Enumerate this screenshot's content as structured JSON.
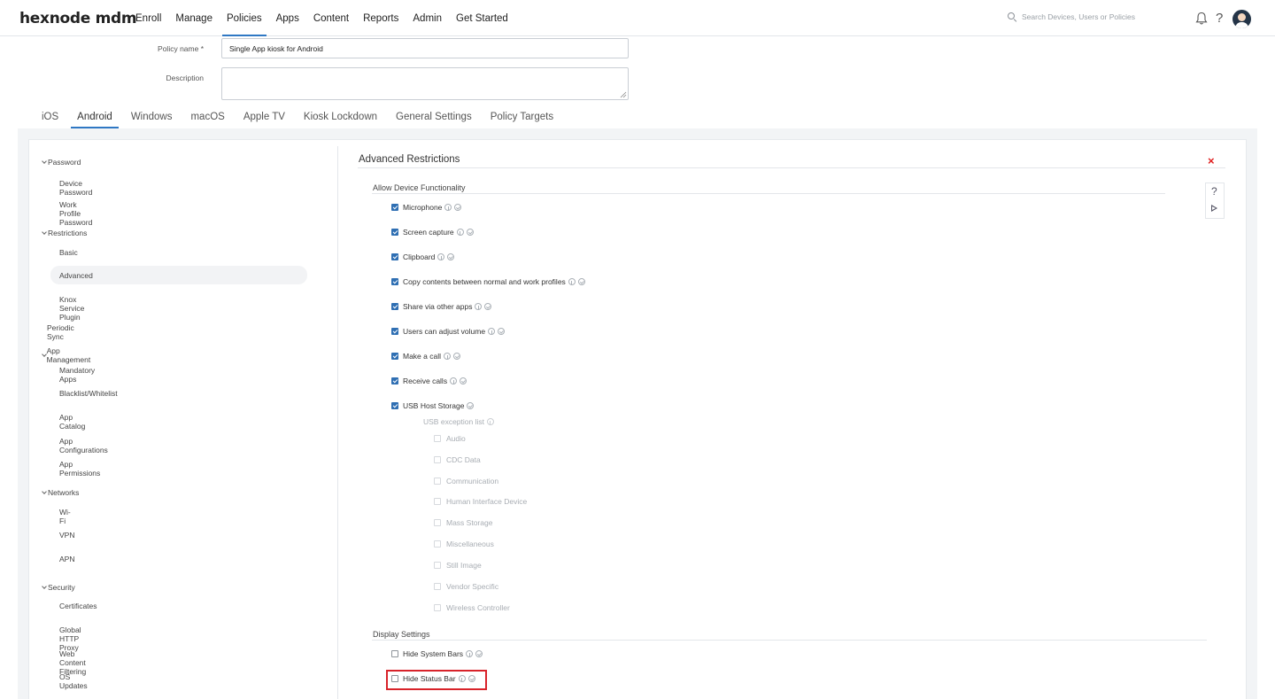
{
  "brand": {
    "logo": "hexnode mdm"
  },
  "nav": {
    "items": [
      "Enroll",
      "Manage",
      "Policies",
      "Apps",
      "Content",
      "Reports",
      "Admin",
      "Get Started"
    ],
    "active": "Policies"
  },
  "search": {
    "placeholder": "Search Devices, Users or Policies"
  },
  "header_icons": {
    "bell": "bell-icon",
    "help": "?",
    "avatar": "avatar"
  },
  "form": {
    "policy_name_label": "Policy name *",
    "policy_name_value": "Single App kiosk for Android",
    "description_label": "Description",
    "description_value": ""
  },
  "tabs": {
    "items": [
      "iOS",
      "Android",
      "Windows",
      "macOS",
      "Apple TV",
      "Kiosk Lockdown",
      "General Settings",
      "Policy Targets"
    ],
    "active": "Android"
  },
  "sidebar": {
    "password": {
      "title": "Password",
      "items": [
        "Device Password",
        "Work Profile Password"
      ]
    },
    "restrictions": {
      "title": "Restrictions",
      "items": [
        "Basic",
        "Advanced",
        "Knox Service Plugin"
      ],
      "active": "Advanced"
    },
    "periodic_sync": "Periodic Sync",
    "app_management": {
      "title": "App Management",
      "items": [
        "Mandatory Apps",
        "Blacklist/Whitelist",
        "App Catalog",
        "App Configurations",
        "App Permissions"
      ]
    },
    "networks": {
      "title": "Networks",
      "items": [
        "Wi-Fi",
        "VPN",
        "APN"
      ]
    },
    "security": {
      "title": "Security",
      "items": [
        "Certificates",
        "Global HTTP Proxy",
        "Web Content Filtering",
        "OS Updates"
      ]
    }
  },
  "main": {
    "title": "Advanced Restrictions",
    "close": "×",
    "tools": {
      "help": "?"
    },
    "allow_section": {
      "title": "Allow Device Functionality",
      "options": [
        {
          "label": "Microphone",
          "checked": true,
          "info": true
        },
        {
          "label": "Screen capture",
          "checked": true,
          "info": true
        },
        {
          "label": "Clipboard",
          "checked": true,
          "info": true
        },
        {
          "label": "Copy contents between normal and work profiles",
          "checked": true,
          "info": true
        },
        {
          "label": "Share via other apps",
          "checked": true,
          "info": true
        },
        {
          "label": "Users can adjust volume",
          "checked": true,
          "info": true
        },
        {
          "label": "Make a call",
          "checked": true,
          "info": true
        },
        {
          "label": "Receive calls",
          "checked": true,
          "info": true
        },
        {
          "label": "USB Host Storage",
          "checked": true,
          "info": false
        }
      ],
      "usb_exception": {
        "label": "USB exception list",
        "options": [
          "Audio",
          "CDC Data",
          "Communication",
          "Human Interface Device",
          "Mass Storage",
          "Miscellaneous",
          "Still Image",
          "Vendor Specific",
          "Wireless Controller"
        ]
      }
    },
    "display_section": {
      "title": "Display Settings",
      "options": [
        {
          "label": "Hide System Bars",
          "checked": false
        },
        {
          "label": "Hide Status Bar",
          "checked": false,
          "highlighted": true
        }
      ]
    }
  },
  "colors": {
    "accent": "#2f78c4",
    "checkbox": "#2f6fb3",
    "highlight": "#d8232a",
    "close": "#e02020"
  }
}
